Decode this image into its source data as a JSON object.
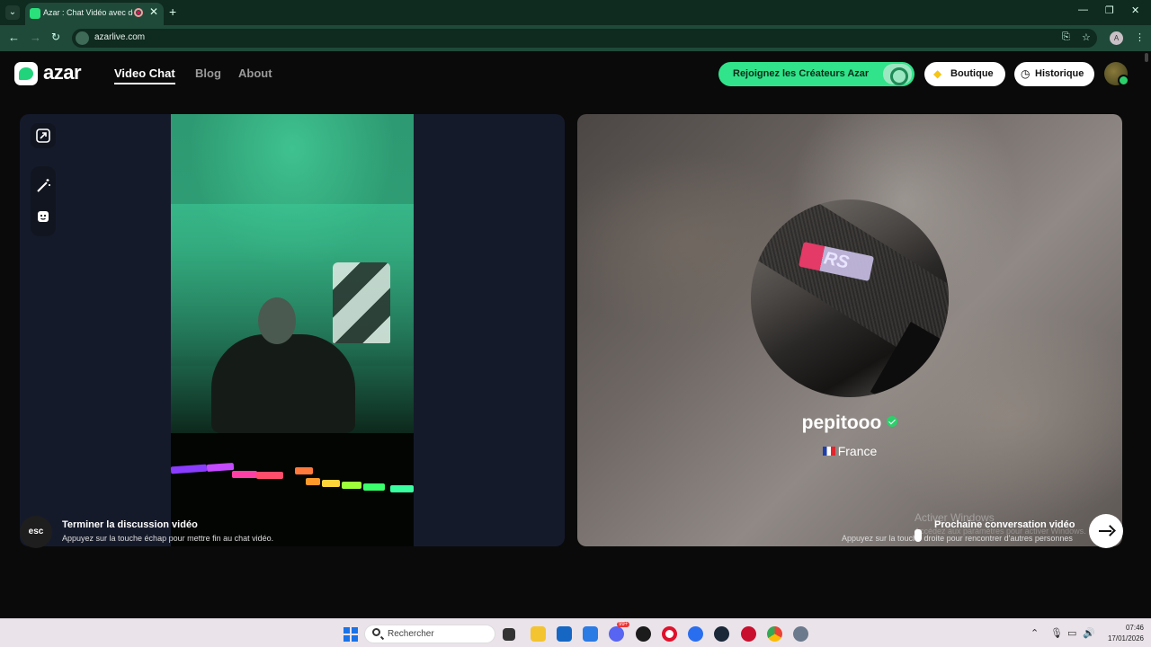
{
  "browser": {
    "tab_title": "Azar : Chat Vidéo avec de n",
    "url": "azarlive.com",
    "profile_initial": "A"
  },
  "site": {
    "logo_text": "azar",
    "nav": [
      "Video Chat",
      "Blog",
      "About"
    ],
    "creators_label": "Rejoignez les Créateurs Azar",
    "shop_label": "Boutique",
    "history_label": "Historique"
  },
  "remote": {
    "name": "pepitooo",
    "country": "France",
    "avatar_text": "RS"
  },
  "footer": {
    "esc_label": "esc",
    "end_title": "Terminer la discussion vidéo",
    "end_sub": "Appuyez sur la touche échap pour mettre fin au chat vidéo.",
    "next_title": "Prochaine conversation vidéo",
    "next_sub": "Appuyez sur la touche droite pour rencontrer d'autres personnes",
    "watermark_title": "Activer Windows",
    "watermark_sub": "Accédez aux paramètres pour activer Windows."
  },
  "taskbar": {
    "search_placeholder": "Rechercher",
    "time": "07:46",
    "date": "17/01/2026",
    "chat_badge": "99+"
  },
  "colors": {
    "accent_green": "#31e38a",
    "browser_frame": "#1f4a3a",
    "page_bg": "#0a0a0a"
  }
}
